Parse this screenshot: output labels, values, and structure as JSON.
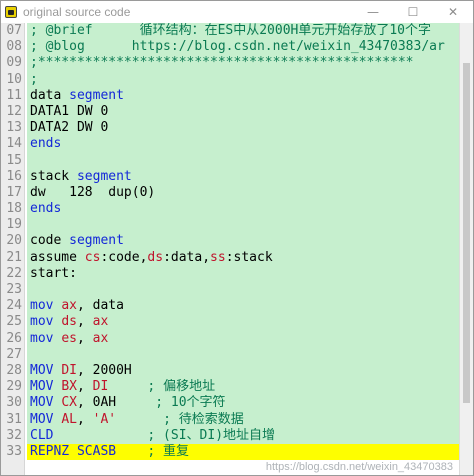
{
  "window": {
    "title": "original source code"
  },
  "controls": {
    "minimize": "—",
    "maximize": "☐",
    "close": "✕"
  },
  "lines": [
    {
      "num": "07",
      "tokens": [
        {
          "t": "; @brief      循环结构：在ES中从2000H单元开始存放了10个字",
          "c": "com"
        }
      ]
    },
    {
      "num": "08",
      "tokens": [
        {
          "t": "; @blog      https://blog.csdn.net/weixin_43470383/ar",
          "c": "com"
        }
      ]
    },
    {
      "num": "09",
      "tokens": [
        {
          "t": ";************************************************",
          "c": "com"
        }
      ]
    },
    {
      "num": "10",
      "tokens": [
        {
          "t": ";",
          "c": "com"
        }
      ]
    },
    {
      "num": "11",
      "tokens": [
        {
          "t": "data ",
          "c": ""
        },
        {
          "t": "segment",
          "c": "kw"
        }
      ]
    },
    {
      "num": "12",
      "tokens": [
        {
          "t": "DATA1 DW 0",
          "c": ""
        }
      ]
    },
    {
      "num": "13",
      "tokens": [
        {
          "t": "DATA2 DW 0",
          "c": ""
        }
      ]
    },
    {
      "num": "14",
      "tokens": [
        {
          "t": "ends",
          "c": "kw"
        }
      ]
    },
    {
      "num": "15",
      "tokens": []
    },
    {
      "num": "16",
      "tokens": [
        {
          "t": "stack ",
          "c": ""
        },
        {
          "t": "segment",
          "c": "kw"
        }
      ]
    },
    {
      "num": "17",
      "tokens": [
        {
          "t": "dw   128  dup(0)",
          "c": ""
        }
      ]
    },
    {
      "num": "18",
      "tokens": [
        {
          "t": "ends",
          "c": "kw"
        }
      ]
    },
    {
      "num": "19",
      "tokens": []
    },
    {
      "num": "20",
      "tokens": [
        {
          "t": "code ",
          "c": ""
        },
        {
          "t": "segment",
          "c": "kw"
        }
      ]
    },
    {
      "num": "21",
      "tokens": [
        {
          "t": "assume ",
          "c": ""
        },
        {
          "t": "cs",
          "c": "reg"
        },
        {
          "t": ":code,",
          "c": ""
        },
        {
          "t": "ds",
          "c": "reg"
        },
        {
          "t": ":data,",
          "c": ""
        },
        {
          "t": "ss",
          "c": "reg"
        },
        {
          "t": ":stack",
          "c": ""
        }
      ]
    },
    {
      "num": "22",
      "tokens": [
        {
          "t": "start:",
          "c": ""
        }
      ]
    },
    {
      "num": "23",
      "tokens": []
    },
    {
      "num": "24",
      "tokens": [
        {
          "t": "mov ",
          "c": "kw"
        },
        {
          "t": "ax",
          "c": "reg"
        },
        {
          "t": ", data",
          "c": ""
        }
      ]
    },
    {
      "num": "25",
      "tokens": [
        {
          "t": "mov ",
          "c": "kw"
        },
        {
          "t": "ds",
          "c": "reg"
        },
        {
          "t": ", ",
          "c": ""
        },
        {
          "t": "ax",
          "c": "reg"
        }
      ]
    },
    {
      "num": "26",
      "tokens": [
        {
          "t": "mov ",
          "c": "kw"
        },
        {
          "t": "es",
          "c": "reg"
        },
        {
          "t": ", ",
          "c": ""
        },
        {
          "t": "ax",
          "c": "reg"
        }
      ]
    },
    {
      "num": "27",
      "tokens": []
    },
    {
      "num": "28",
      "tokens": [
        {
          "t": "MOV ",
          "c": "kw"
        },
        {
          "t": "DI",
          "c": "reg"
        },
        {
          "t": ", 2000H",
          "c": ""
        }
      ]
    },
    {
      "num": "29",
      "tokens": [
        {
          "t": "MOV ",
          "c": "kw"
        },
        {
          "t": "BX",
          "c": "reg"
        },
        {
          "t": ", ",
          "c": ""
        },
        {
          "t": "DI",
          "c": "reg"
        },
        {
          "t": "     ; 偏移地址",
          "c": "com"
        }
      ]
    },
    {
      "num": "30",
      "tokens": [
        {
          "t": "MOV ",
          "c": "kw"
        },
        {
          "t": "CX",
          "c": "reg"
        },
        {
          "t": ", 0AH",
          "c": ""
        },
        {
          "t": "     ; 10个字符",
          "c": "com"
        }
      ]
    },
    {
      "num": "31",
      "tokens": [
        {
          "t": "MOV ",
          "c": "kw"
        },
        {
          "t": "AL",
          "c": "reg"
        },
        {
          "t": ", ",
          "c": ""
        },
        {
          "t": "'A'",
          "c": "str"
        },
        {
          "t": "      ; 待检索数据",
          "c": "com"
        }
      ]
    },
    {
      "num": "32",
      "tokens": [
        {
          "t": "CLD",
          "c": "kw"
        },
        {
          "t": "            ; (SI、DI)地址自增",
          "c": "com"
        }
      ]
    },
    {
      "num": "33",
      "highlight": true,
      "tokens": [
        {
          "t": "REPNZ SCASB",
          "c": "kw"
        },
        {
          "t": "    ; 重复",
          "c": "com"
        }
      ]
    }
  ],
  "watermark": "https://blog.csdn.net/weixin_43470383",
  "colors": {
    "line_bg": "#c6efce",
    "highlight_bg": "#fefe00",
    "keyword": "#1428d8",
    "register": "#c0142c",
    "comment": "#0a7a52"
  }
}
